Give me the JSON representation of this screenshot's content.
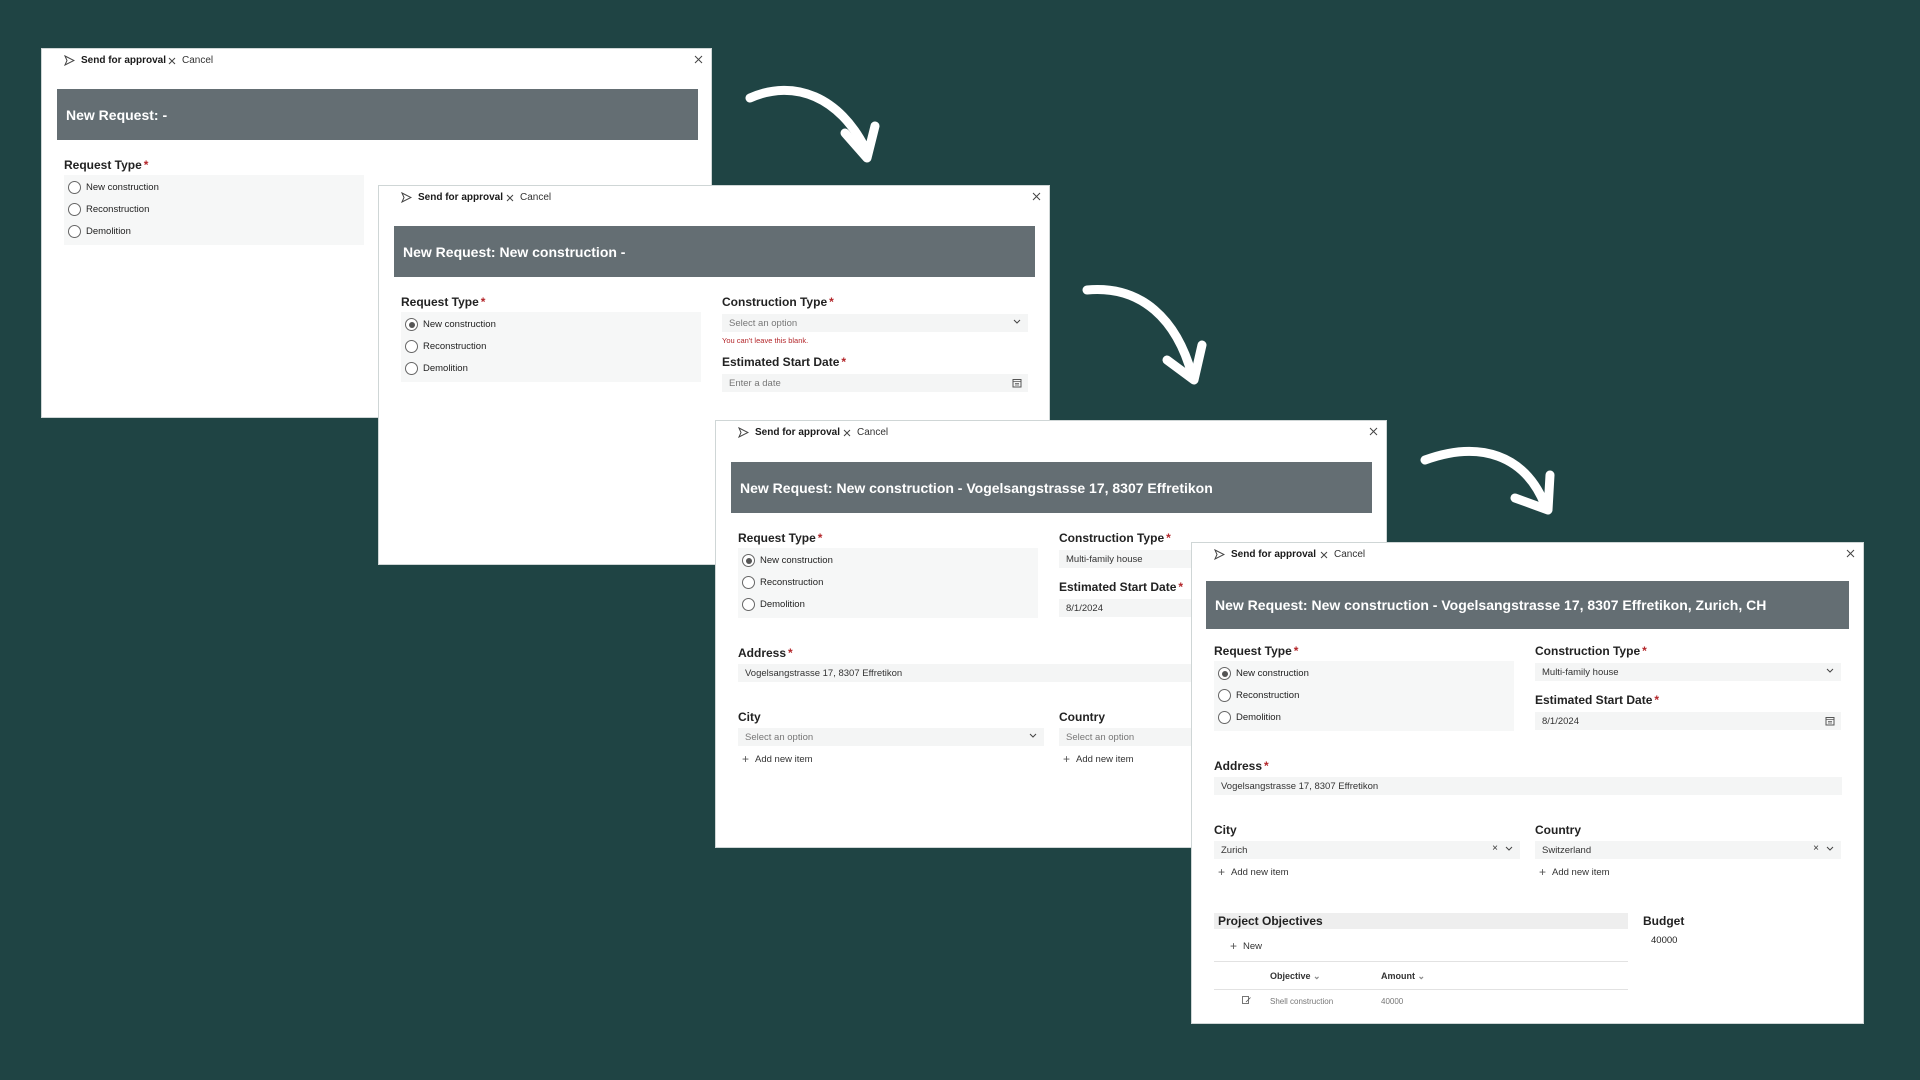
{
  "toolbar": {
    "send_label": "Send for approval",
    "cancel_label": "Cancel"
  },
  "labels": {
    "request_type": "Request Type",
    "construction_type": "Construction Type",
    "estimated_start_date": "Estimated Start Date",
    "address": "Address",
    "city": "City",
    "country": "Country",
    "project_objectives": "Project Objectives",
    "budget": "Budget",
    "required_mark": "*"
  },
  "request_type_options": [
    "New construction",
    "Reconstruction",
    "Demolition"
  ],
  "common": {
    "select_placeholder": "Select an option",
    "date_placeholder": "Enter a date",
    "blank_error": "You can't leave this blank.",
    "add_new_item": "Add new item",
    "new_label": "New"
  },
  "step1": {
    "title": "New Request: -"
  },
  "step2": {
    "title": "New Request: New construction -"
  },
  "step3": {
    "title": "New Request: New construction - Vogelsangstrasse 17, 8307 Effretikon",
    "construction_type": "Multi-family house",
    "start_date": "8/1/2024",
    "address": "Vogelsangstrasse 17, 8307 Effretikon"
  },
  "step4": {
    "title": "New Request: New construction - Vogelsangstrasse 17, 8307 Effretikon, Zurich, CH",
    "construction_type": "Multi-family house",
    "start_date": "8/1/2024",
    "address": "Vogelsangstrasse 17, 8307 Effretikon",
    "city": "Zurich",
    "country": "Switzerland",
    "budget": "40000",
    "objectives_columns": [
      "Objective",
      "Amount"
    ],
    "objectives_rows": [
      {
        "objective": "Shell construction",
        "amount": "40000"
      }
    ]
  },
  "colors": {
    "background": "#1f4444",
    "header": "#646e73",
    "required": "#b3262a"
  }
}
